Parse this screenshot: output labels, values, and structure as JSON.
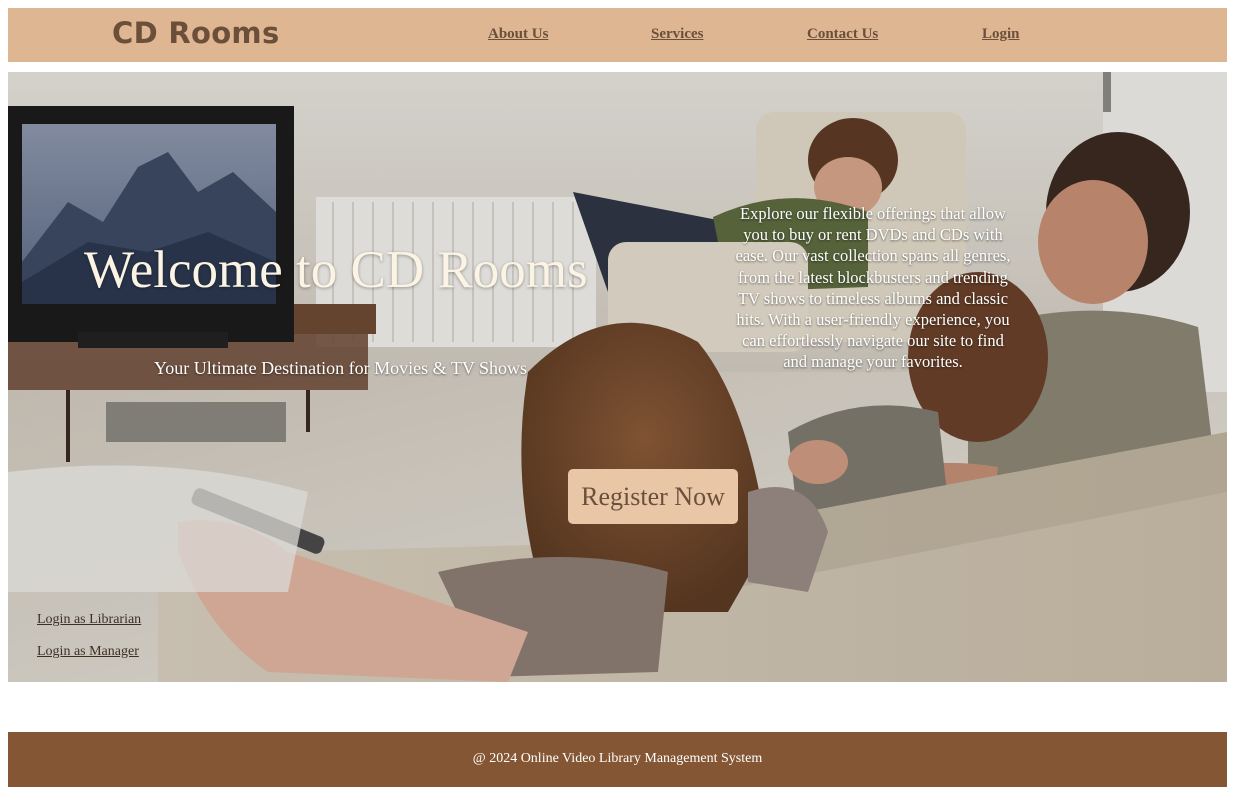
{
  "header": {
    "logo": "CD Rooms",
    "nav": [
      "About Us",
      "Services",
      "Contact Us",
      "Login"
    ],
    "background_color": "#deb792",
    "text_color": "#6b4f3b"
  },
  "hero": {
    "title": "Welcome to CD Rooms",
    "subtitle": "Your Ultimate Destination for Movies & TV Shows",
    "description": "Explore our flexible offerings that allow you to buy or rent DVDs and CDs with ease. Our vast collection spans all genres, from the latest blockbusters and trending TV shows to timeless albums and classic hits. With a user-friendly experience, you can effortlessly navigate our site to find and manage your favorites.",
    "register_button": "Register Now",
    "login_librarian": "Login as Librarian",
    "login_manager": "Login as Manager",
    "background_image": "family-watching-tv-photo",
    "button_color": "#e8c6a6"
  },
  "footer": {
    "text": "@ 2024 Online Video Library Management System",
    "background_color": "#845634"
  }
}
